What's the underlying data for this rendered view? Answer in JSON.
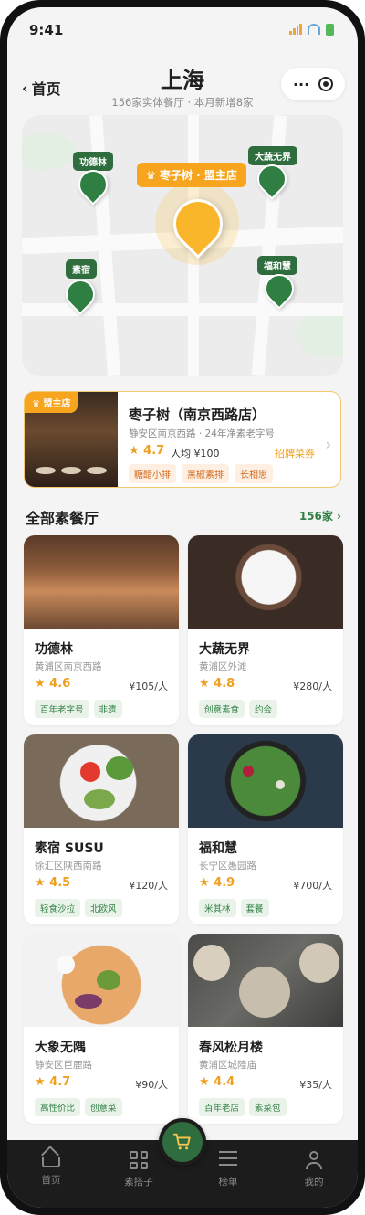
{
  "status": {
    "time": "9:41"
  },
  "nav": {
    "back_label": "首页",
    "title": "上海",
    "subtitle": "156家实体餐厅 · 本月新增8家"
  },
  "map": {
    "main_label": "枣子树 · 盟主店",
    "pins": [
      "功德林",
      "大蔬无界",
      "素宿",
      "福和慧"
    ]
  },
  "featured": {
    "badge": "盟主店",
    "name": "枣子树（南京西路店）",
    "meta": "静安区南京西路 · 24年净素老字号",
    "rating": "★ 4.7",
    "avg": "人均 ¥100",
    "signature_label": "招牌菜券",
    "tags": [
      "糖醋小排",
      "黑椒素排",
      "长相思"
    ]
  },
  "section": {
    "title": "全部素餐厅",
    "count": "156家 ›"
  },
  "restaurants": [
    {
      "name": "功德林",
      "addr": "黄浦区南京西路",
      "rating": "★ 4.6",
      "price": "¥105/人",
      "tags": [
        "百年老字号",
        "非遗"
      ]
    },
    {
      "name": "大蔬无界",
      "addr": "黄浦区外滩",
      "rating": "★ 4.8",
      "price": "¥280/人",
      "tags": [
        "创意素食",
        "约会"
      ]
    },
    {
      "name": "素宿 SUSU",
      "addr": "徐汇区陕西南路",
      "rating": "★ 4.5",
      "price": "¥120/人",
      "tags": [
        "轻食沙拉",
        "北欧风"
      ]
    },
    {
      "name": "福和慧",
      "addr": "长宁区愚园路",
      "rating": "★ 4.9",
      "price": "¥700/人",
      "tags": [
        "米其林",
        "套餐"
      ]
    },
    {
      "name": "大象无隅",
      "addr": "静安区巨鹿路",
      "rating": "★ 4.7",
      "price": "¥90/人",
      "tags": [
        "高性价比",
        "创意菜"
      ]
    },
    {
      "name": "春风松月楼",
      "addr": "黄浦区城隍庙",
      "rating": "★ 4.4",
      "price": "¥35/人",
      "tags": [
        "百年老店",
        "素菜包"
      ]
    }
  ],
  "tabs": [
    "首页",
    "素搭子",
    "榜单",
    "我的"
  ],
  "colors": {
    "brand_green": "#2f7f43",
    "accent_orange": "#f7a51e",
    "rating": "#f0a020"
  }
}
